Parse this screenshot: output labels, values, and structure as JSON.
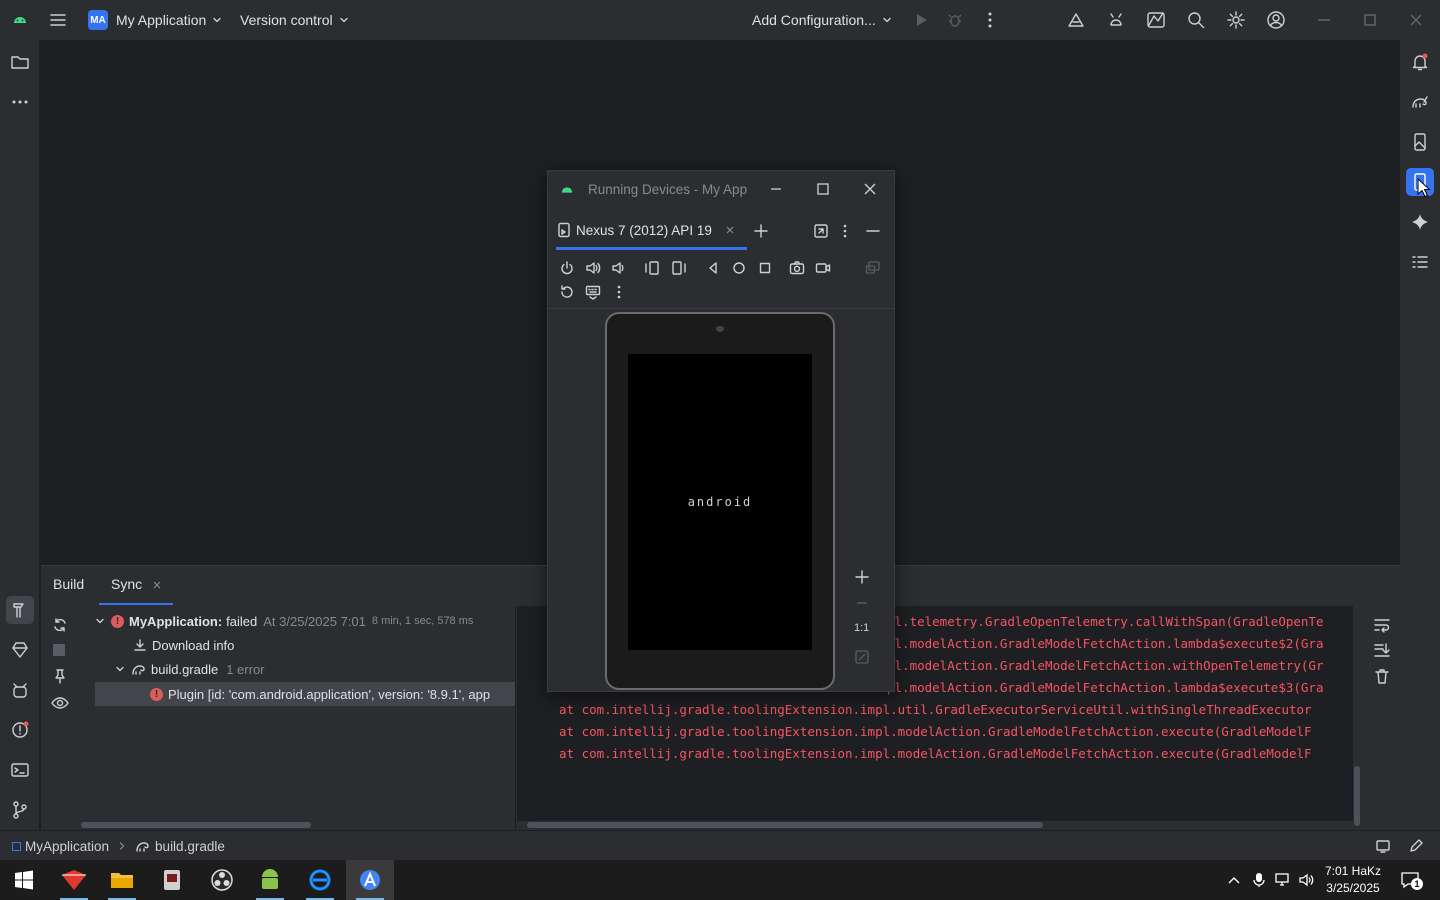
{
  "titlebar": {
    "project_badge": "MA",
    "project_name": "My Application",
    "vcs": "Version control",
    "run_config": "Add Configuration..."
  },
  "running_devices": {
    "title": "Running Devices - My App",
    "tab_label": "Nexus 7 (2012) API 19",
    "boot_text": "android",
    "zoom_label": "1:1"
  },
  "build_panel": {
    "tabs": [
      "Build",
      "Sync"
    ],
    "tree": {
      "root_label": "MyApplication:",
      "root_status": "failed",
      "root_time": "At 3/25/2025 7:01",
      "root_duration": "8 min, 1 sec, 578 ms",
      "download": "Download info",
      "file": "build.gradle",
      "file_errors": "1 error",
      "error_message": "Plugin [id: 'com.android.application', version: '8.9.1', app"
    },
    "console": [
      "pl.telemetry.GradleOpenTelemetry.callWithSpan(GradleOpenTe",
      "pl.modelAction.GradleModelFetchAction.lambda$execute$2(Gra",
      "pl.modelAction.GradleModelFetchAction.withOpenTelemetry(Gr",
      "pl.modelAction.GradleModelFetchAction.lambda$execute$3(Gra",
      "at com.intellij.gradle.toolingExtension.impl.util.GradleExecutorServiceUtil.withSingleThreadExecutor",
      "at com.intellij.gradle.toolingExtension.impl.modelAction.GradleModelFetchAction.execute(GradleModelF",
      "at com.intellij.gradle.toolingExtension.impl.modelAction.GradleModelFetchAction.execute(GradleModelF"
    ]
  },
  "statusbar": {
    "crumb_project": "MyApplication",
    "crumb_file": "build.gradle"
  },
  "taskbar": {
    "time": "7:01 HaKz",
    "date": "3/25/2025"
  },
  "colors": {
    "accent": "#3574f0",
    "error": "#db5c5c",
    "console_error": "#f75464"
  }
}
